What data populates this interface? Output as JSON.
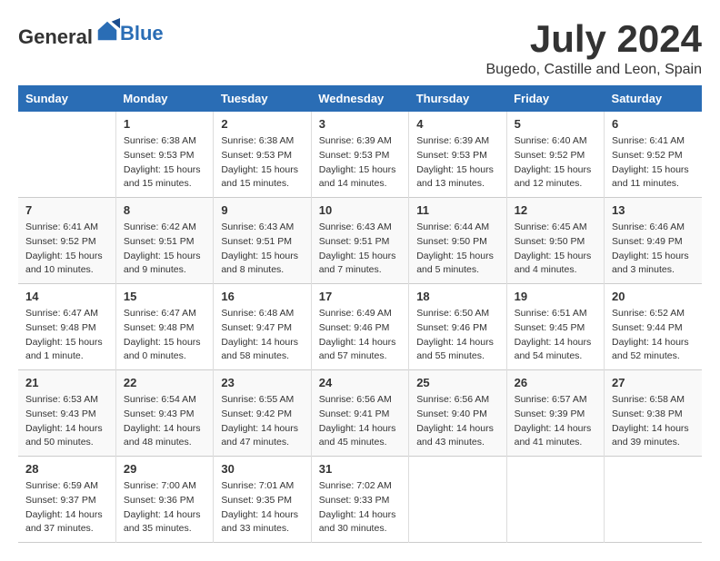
{
  "logo": {
    "general": "General",
    "blue": "Blue"
  },
  "title": "July 2024",
  "location": "Bugedo, Castille and Leon, Spain",
  "weekdays": [
    "Sunday",
    "Monday",
    "Tuesday",
    "Wednesday",
    "Thursday",
    "Friday",
    "Saturday"
  ],
  "weeks": [
    [
      {
        "day": "",
        "info": ""
      },
      {
        "day": "1",
        "info": "Sunrise: 6:38 AM\nSunset: 9:53 PM\nDaylight: 15 hours\nand 15 minutes."
      },
      {
        "day": "2",
        "info": "Sunrise: 6:38 AM\nSunset: 9:53 PM\nDaylight: 15 hours\nand 15 minutes."
      },
      {
        "day": "3",
        "info": "Sunrise: 6:39 AM\nSunset: 9:53 PM\nDaylight: 15 hours\nand 14 minutes."
      },
      {
        "day": "4",
        "info": "Sunrise: 6:39 AM\nSunset: 9:53 PM\nDaylight: 15 hours\nand 13 minutes."
      },
      {
        "day": "5",
        "info": "Sunrise: 6:40 AM\nSunset: 9:52 PM\nDaylight: 15 hours\nand 12 minutes."
      },
      {
        "day": "6",
        "info": "Sunrise: 6:41 AM\nSunset: 9:52 PM\nDaylight: 15 hours\nand 11 minutes."
      }
    ],
    [
      {
        "day": "7",
        "info": "Sunrise: 6:41 AM\nSunset: 9:52 PM\nDaylight: 15 hours\nand 10 minutes."
      },
      {
        "day": "8",
        "info": "Sunrise: 6:42 AM\nSunset: 9:51 PM\nDaylight: 15 hours\nand 9 minutes."
      },
      {
        "day": "9",
        "info": "Sunrise: 6:43 AM\nSunset: 9:51 PM\nDaylight: 15 hours\nand 8 minutes."
      },
      {
        "day": "10",
        "info": "Sunrise: 6:43 AM\nSunset: 9:51 PM\nDaylight: 15 hours\nand 7 minutes."
      },
      {
        "day": "11",
        "info": "Sunrise: 6:44 AM\nSunset: 9:50 PM\nDaylight: 15 hours\nand 5 minutes."
      },
      {
        "day": "12",
        "info": "Sunrise: 6:45 AM\nSunset: 9:50 PM\nDaylight: 15 hours\nand 4 minutes."
      },
      {
        "day": "13",
        "info": "Sunrise: 6:46 AM\nSunset: 9:49 PM\nDaylight: 15 hours\nand 3 minutes."
      }
    ],
    [
      {
        "day": "14",
        "info": "Sunrise: 6:47 AM\nSunset: 9:48 PM\nDaylight: 15 hours\nand 1 minute."
      },
      {
        "day": "15",
        "info": "Sunrise: 6:47 AM\nSunset: 9:48 PM\nDaylight: 15 hours\nand 0 minutes."
      },
      {
        "day": "16",
        "info": "Sunrise: 6:48 AM\nSunset: 9:47 PM\nDaylight: 14 hours\nand 58 minutes."
      },
      {
        "day": "17",
        "info": "Sunrise: 6:49 AM\nSunset: 9:46 PM\nDaylight: 14 hours\nand 57 minutes."
      },
      {
        "day": "18",
        "info": "Sunrise: 6:50 AM\nSunset: 9:46 PM\nDaylight: 14 hours\nand 55 minutes."
      },
      {
        "day": "19",
        "info": "Sunrise: 6:51 AM\nSunset: 9:45 PM\nDaylight: 14 hours\nand 54 minutes."
      },
      {
        "day": "20",
        "info": "Sunrise: 6:52 AM\nSunset: 9:44 PM\nDaylight: 14 hours\nand 52 minutes."
      }
    ],
    [
      {
        "day": "21",
        "info": "Sunrise: 6:53 AM\nSunset: 9:43 PM\nDaylight: 14 hours\nand 50 minutes."
      },
      {
        "day": "22",
        "info": "Sunrise: 6:54 AM\nSunset: 9:43 PM\nDaylight: 14 hours\nand 48 minutes."
      },
      {
        "day": "23",
        "info": "Sunrise: 6:55 AM\nSunset: 9:42 PM\nDaylight: 14 hours\nand 47 minutes."
      },
      {
        "day": "24",
        "info": "Sunrise: 6:56 AM\nSunset: 9:41 PM\nDaylight: 14 hours\nand 45 minutes."
      },
      {
        "day": "25",
        "info": "Sunrise: 6:56 AM\nSunset: 9:40 PM\nDaylight: 14 hours\nand 43 minutes."
      },
      {
        "day": "26",
        "info": "Sunrise: 6:57 AM\nSunset: 9:39 PM\nDaylight: 14 hours\nand 41 minutes."
      },
      {
        "day": "27",
        "info": "Sunrise: 6:58 AM\nSunset: 9:38 PM\nDaylight: 14 hours\nand 39 minutes."
      }
    ],
    [
      {
        "day": "28",
        "info": "Sunrise: 6:59 AM\nSunset: 9:37 PM\nDaylight: 14 hours\nand 37 minutes."
      },
      {
        "day": "29",
        "info": "Sunrise: 7:00 AM\nSunset: 9:36 PM\nDaylight: 14 hours\nand 35 minutes."
      },
      {
        "day": "30",
        "info": "Sunrise: 7:01 AM\nSunset: 9:35 PM\nDaylight: 14 hours\nand 33 minutes."
      },
      {
        "day": "31",
        "info": "Sunrise: 7:02 AM\nSunset: 9:33 PM\nDaylight: 14 hours\nand 30 minutes."
      },
      {
        "day": "",
        "info": ""
      },
      {
        "day": "",
        "info": ""
      },
      {
        "day": "",
        "info": ""
      }
    ]
  ]
}
